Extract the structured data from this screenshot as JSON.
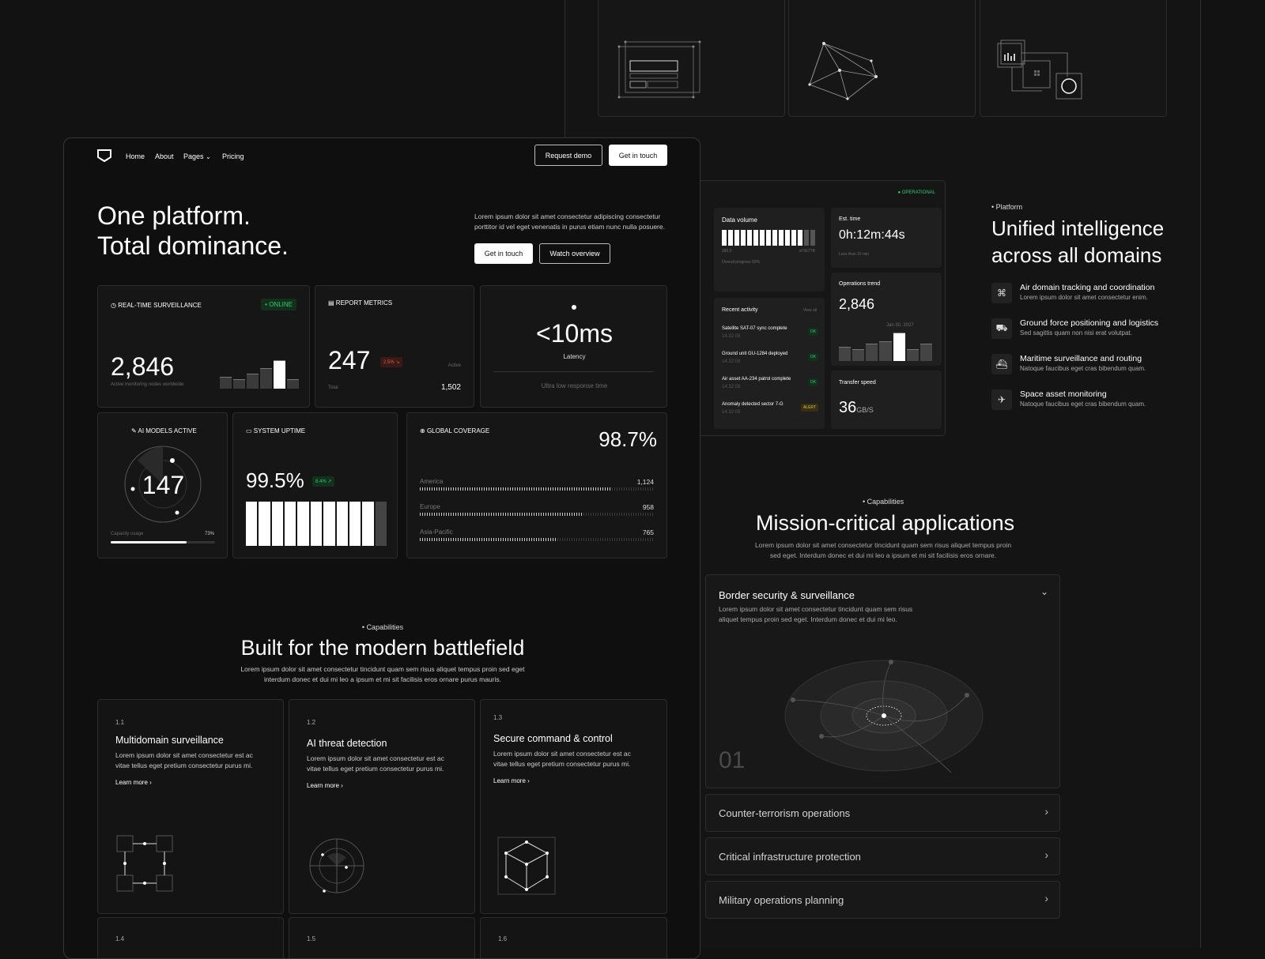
{
  "nav": {
    "items": [
      "Home",
      "About",
      "Pages",
      "Pricing"
    ],
    "request_demo": "Request demo",
    "get_in_touch": "Get in touch"
  },
  "hero": {
    "title_line1": "One platform.",
    "title_line2": "Total dominance.",
    "description": "Lorem ipsum dolor sit amet consectetur adipiscing consectetur porttitor id vel eget venenatis in purus etiam nunc nulla posuere.",
    "cta_primary": "Get in touch",
    "cta_secondary": "Watch overview"
  },
  "surveillance": {
    "label": "REAL-TIME SURVEILLANCE",
    "status": "ONLINE",
    "value": "2,846",
    "caption": "Active monitoring nodes worldwide",
    "bars": [
      0.42,
      0.32,
      0.52,
      0.72,
      1.0,
      0.32
    ]
  },
  "report": {
    "label": "REPORT METRICS",
    "value": "247",
    "change": "2.5%",
    "active_label": "Active",
    "total_label": "Total",
    "total_value": "1,502"
  },
  "latency": {
    "value": "<10ms",
    "label": "Latency",
    "caption": "Ultra low response time"
  },
  "ai_models": {
    "label": "AI MODELS ACTIVE",
    "value": "147",
    "capacity_label": "Capacity usage",
    "capacity_value": "73%",
    "capacity": 0.73
  },
  "uptime": {
    "label": "SYSTEM UPTIME",
    "value": "99.5%",
    "change": "8.4%",
    "segments": 11,
    "filled": 10
  },
  "coverage": {
    "label": "GLOBAL COVERAGE",
    "value": "98.7%",
    "regions": [
      {
        "name": "America",
        "value": "1,124",
        "fill": 0.82
      },
      {
        "name": "Europe",
        "value": "958",
        "fill": 0.7
      },
      {
        "name": "Asia-Pacific",
        "value": "765",
        "fill": 0.58
      }
    ]
  },
  "capabilities": {
    "tag": "Capabilities",
    "title": "Built for the modern battlefield",
    "description": "Lorem ipsum dolor sit amet consectetur tincidunt quam sem risus aliquet tempus proin sed eget interdum donec et dui mi leo a ipsum et mi sit facilisis eros ornare purus mauris.",
    "cards": [
      {
        "num": "1.1",
        "title": "Multidomain surveillance",
        "text": "Lorem ipsum dolor sit amet consectetur est ac vitae tellus eget pretium consectetur purus mi.",
        "link": "Learn more"
      },
      {
        "num": "1.2",
        "title": "AI threat detection",
        "text": "Lorem ipsum dolor sit amet consectetur est ac vitae tellus eget pretium consectetur purus mi.",
        "link": "Learn more"
      },
      {
        "num": "1.3",
        "title": "Secure command & control",
        "text": "Lorem ipsum dolor sit amet consectetur est ac vitae tellus eget pretium consectetur purus mi.",
        "link": "Learn more"
      }
    ],
    "more_nums": [
      "1.4",
      "1.5",
      "1.6"
    ]
  },
  "dashboard": {
    "status": "OPERATIONAL",
    "data_volume": {
      "label": "Data volume",
      "left": "283.5",
      "right": "of 567TB",
      "progress": "Overall progress 50%",
      "bars": 15,
      "filled": 13
    },
    "est_time": {
      "label": "Est. time",
      "value": "0h:12m:44s",
      "caption": "Less than 15 min"
    },
    "recent": {
      "label": "Recent activity",
      "view_all": "View all",
      "items": [
        {
          "title": "Satellite SAT-07 sync complete",
          "time": "14:32:08",
          "badge": "OK",
          "warn": false
        },
        {
          "title": "Ground unit GU-1284 deployed",
          "time": "14:32:08",
          "badge": "OK",
          "warn": false
        },
        {
          "title": "Air asset AA-234 patrol complete",
          "time": "14:32:08",
          "badge": "OK",
          "warn": false
        },
        {
          "title": "Anomaly detected sector 7-G",
          "time": "14:32:08",
          "badge": "ALERT",
          "warn": true
        }
      ]
    },
    "ops_trend": {
      "label": "Operations trend",
      "value": "2,846",
      "date": "Jan 30, 2027",
      "bars": [
        0.5,
        0.42,
        0.62,
        0.7,
        1.0,
        0.42,
        0.62
      ]
    },
    "transfer": {
      "label": "Transfer speed",
      "value": "36",
      "unit": "GB/S"
    }
  },
  "platform": {
    "tag": "Platform",
    "title_line1": "Unified intelligence",
    "title_line2": "across all domains",
    "features": [
      {
        "icon": "command-icon",
        "title": "Air domain tracking and coordination",
        "text": "Lorem ipsum dolor sit amet consectetur enim."
      },
      {
        "icon": "truck-icon",
        "title": "Ground force positioning and logistics",
        "text": "Sed sagittis quam non nisi erat volutpat."
      },
      {
        "icon": "ship-icon",
        "title": "Maritime surveillance and routing",
        "text": "Natoque faucibus eget cras bibendum quam."
      },
      {
        "icon": "satellite-icon",
        "title": "Space asset monitoring",
        "text": "Natoque faucibus eget cras bibendum quam."
      }
    ]
  },
  "mission": {
    "tag": "Capabilities",
    "title": "Mission-critical applications",
    "description": "Lorem ipsum dolor sit amet consectetur tincidunt quam sem risus aliquet tempus proin sed eget. Interdum donec et dui mi leo a ipsum et mi sit facilisis eros ornare.",
    "open": {
      "title": "Border security & surveillance",
      "text": "Lorem ipsum dolor sit amet consectetur tincidunt quam sem risus aliquet tempus proin sed eget. Interdum donec et dui mi leo.",
      "number": "01"
    },
    "items": [
      "Counter-terrorism operations",
      "Critical infrastructure protection",
      "Military operations planning"
    ]
  }
}
